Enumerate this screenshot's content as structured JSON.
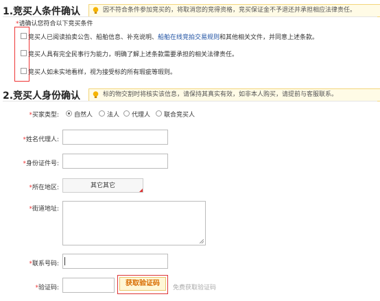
{
  "section1": {
    "title": "1.竞买人条件确认",
    "note": "因不符合条件参加竞买的，将取消您的竞得资格，竞买保证金不予退还并承担相应法律责任。",
    "prompt_star": "*",
    "prompt": "请确认您符合以下竞买条件",
    "conditions": [
      {
        "pre": "竞买人已阅读拍卖公告、船舶信息、补充说明、",
        "link": "船舶在线竞拍交易规则",
        "post": "和其他相关文件，并同意上述条款。"
      },
      {
        "pre": "竞买人具有完全民事行为能力，明确了解上述条款需要承担的相关法律责任。",
        "link": "",
        "post": ""
      },
      {
        "pre": "竞买人如未实地看样，视为接受标的所有瑕疵等瑕则。",
        "link": "",
        "post": ""
      }
    ]
  },
  "section2": {
    "title": "2.竞买人身份确认",
    "note": "标的物交割时将核实该信息，请保持其真实有效，如非本人购买，请提前与客服联系。",
    "buyer_type": {
      "label": "买家类型:",
      "options": [
        "自然人",
        "法人",
        "代理人",
        "联合竞买人"
      ],
      "selected": 0
    },
    "name_label": "姓名代理人:",
    "id_label": "身份证件号:",
    "region_label": "所在地区:",
    "region_value": "其它其它",
    "street_label": "街道地址:",
    "phone_label": "联系号码:",
    "code_label": "验证码:",
    "get_code_button": "获取验证码",
    "free_code_text": "免费获取验证码"
  },
  "colors": {
    "required": "#e33333",
    "link": "#1e50a2",
    "note_bg": "#fffbe6",
    "note_border": "#f3d57a",
    "code_button_text": "#d86b00"
  }
}
